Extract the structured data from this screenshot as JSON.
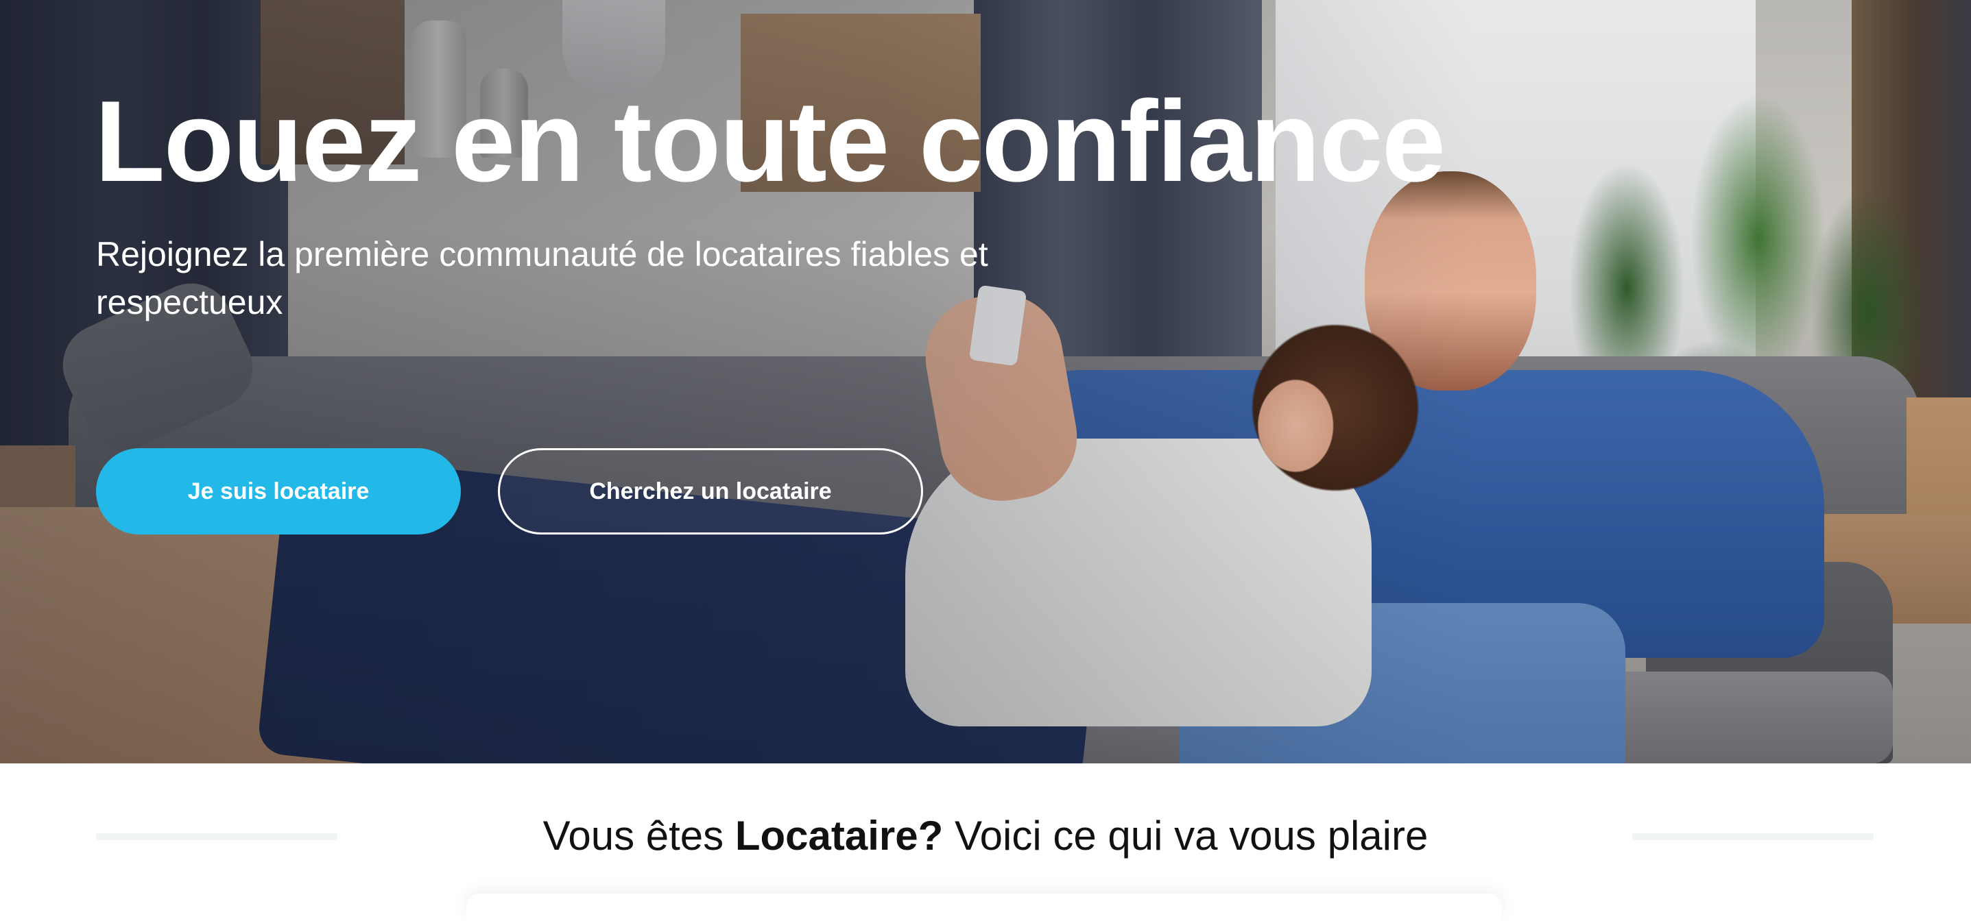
{
  "hero": {
    "title": "Louez en toute confiance",
    "subtitle": "Rejoignez la première communauté de locataires fiables et respectueux",
    "primary_button": "Je suis locataire",
    "secondary_button": "Cherchez un locataire",
    "colors": {
      "primary_button_bg": "#22b8e8",
      "text": "#ffffff"
    }
  },
  "section": {
    "heading_prefix": "Vous êtes ",
    "heading_bold": "Locataire?",
    "heading_suffix": " Voici ce qui va vous plaire"
  }
}
